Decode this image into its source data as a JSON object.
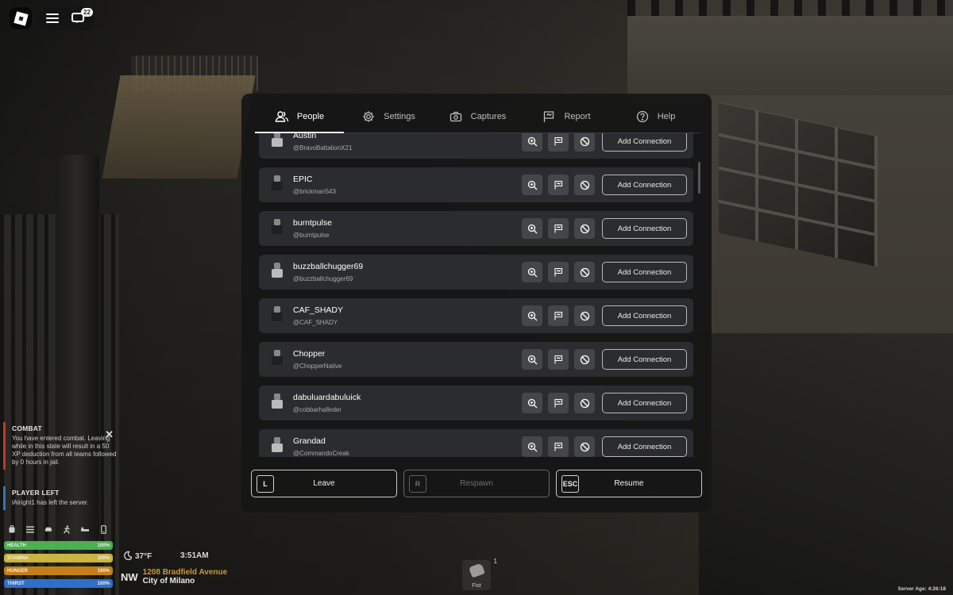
{
  "topbar": {
    "chat_badge": "22"
  },
  "menu": {
    "tabs": [
      {
        "label": "People",
        "icon": "people-icon",
        "active": true
      },
      {
        "label": "Settings",
        "icon": "gear-icon",
        "active": false
      },
      {
        "label": "Captures",
        "icon": "camera-icon",
        "active": false
      },
      {
        "label": "Report",
        "icon": "flag-icon",
        "active": false
      },
      {
        "label": "Help",
        "icon": "help-icon",
        "active": false
      }
    ],
    "players": [
      {
        "name": "Austin",
        "handle": "@BravoBattalionX21",
        "action": "Add Connection"
      },
      {
        "name": "EPIC",
        "handle": "@brickman543",
        "action": "Add Connection"
      },
      {
        "name": "burntpulse",
        "handle": "@burntpulse",
        "action": "Add Connection"
      },
      {
        "name": "buzzballchugger69",
        "handle": "@buzzballchugger69",
        "action": "Add Connection"
      },
      {
        "name": "CAF_SHADY",
        "handle": "@CAF_SHADY",
        "action": "Add Connection"
      },
      {
        "name": "Chopper",
        "handle": "@ChopperNative",
        "action": "Add Connection"
      },
      {
        "name": "dabuluardabuluick",
        "handle": "@cobbarhalleder",
        "action": "Add Connection"
      },
      {
        "name": "Grandad",
        "handle": "@CommandoCreak",
        "action": "Add Connection"
      }
    ],
    "bottom": {
      "leave": {
        "key": "L",
        "label": "Leave"
      },
      "respawn": {
        "key": "R",
        "label": "Respawn"
      },
      "resume": {
        "key": "ESC",
        "label": "Resume"
      }
    }
  },
  "notifications": {
    "combat": {
      "title": "COMBAT",
      "body": "You have entered combat. Leaving while in this state will result in a 50 XP deduction from all teams followed by 0 hours in jail."
    },
    "player_left": {
      "title": "PLAYER LEFT",
      "body": "lAlright1 has left the server."
    }
  },
  "stats": [
    {
      "label": "HEALTH",
      "value": "100%",
      "fraction": 1.0,
      "color": "#4caf50"
    },
    {
      "label": "STAMINA",
      "value": "100%",
      "fraction": 1.0,
      "color": "#c9b540"
    },
    {
      "label": "HUNGER",
      "value": "100%",
      "fraction": 1.0,
      "color": "#c47f1a"
    },
    {
      "label": "THIRST",
      "value": "100%",
      "fraction": 1.0,
      "color": "#2f6fc9"
    }
  ],
  "hud": {
    "temperature": "37°F",
    "time": "3:51AM",
    "compass": "NW",
    "street": "1208 Bradfield Avenue",
    "city": "City of Milano",
    "hotbar": {
      "slot": "1",
      "item": "Fist"
    },
    "server_age": "Server Age: 4:26:18"
  }
}
